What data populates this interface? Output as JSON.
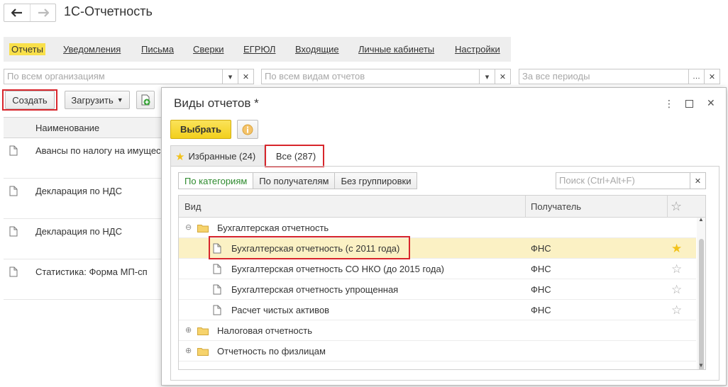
{
  "app": {
    "title": "1С-Отчетность"
  },
  "nav_tabs": [
    {
      "label": "Отчеты",
      "active": true
    },
    {
      "label": "Уведомления",
      "active": false
    },
    {
      "label": "Письма",
      "active": false
    },
    {
      "label": "Сверки",
      "active": false
    },
    {
      "label": "ЕГРЮЛ",
      "active": false
    },
    {
      "label": "Входящие",
      "active": false
    },
    {
      "label": "Личные кабинеты",
      "active": false
    },
    {
      "label": "Настройки",
      "active": false
    }
  ],
  "filters": {
    "organizations_placeholder": "По всем организациям",
    "report_types_placeholder": "По всем видам отчетов",
    "periods_placeholder": "За все периоды"
  },
  "toolbar": {
    "create": "Создать",
    "load": "Загрузить"
  },
  "list": {
    "header": "Наименование",
    "rows": [
      "Авансы по налогу на имущес",
      "Декларация по НДС",
      "Декларация по НДС",
      "Статистика: Форма МП-сп"
    ]
  },
  "dialog": {
    "title": "Виды отчетов *",
    "select_button": "Выбрать",
    "tabs": [
      {
        "label": "Избранные (24)",
        "active": false
      },
      {
        "label": "Все (287)",
        "active": true
      }
    ],
    "grouping": [
      {
        "label": "По категориям",
        "active": true
      },
      {
        "label": "По получателям",
        "active": false
      },
      {
        "label": "Без группировки",
        "active": false
      }
    ],
    "search_placeholder": "Поиск (Ctrl+Alt+F)",
    "columns": {
      "kind": "Вид",
      "recipient": "Получатель"
    },
    "rows": [
      {
        "type": "group",
        "label": "Бухгалтерская отчетность",
        "expanded": true
      },
      {
        "type": "item",
        "label": "Бухгалтерская отчетность (с 2011 года)",
        "recipient": "ФНС",
        "favorite": true,
        "selected": true
      },
      {
        "type": "item",
        "label": "Бухгалтерская отчетность СО НКО (до 2015 года)",
        "recipient": "ФНС",
        "favorite": false
      },
      {
        "type": "item",
        "label": "Бухгалтерская отчетность упрощенная",
        "recipient": "ФНС",
        "favorite": false
      },
      {
        "type": "item",
        "label": "Расчет чистых активов",
        "recipient": "ФНС",
        "favorite": false
      },
      {
        "type": "group",
        "label": "Налоговая отчетность",
        "expanded": false
      },
      {
        "type": "group",
        "label": "Отчетность по физлицам",
        "expanded": false
      }
    ]
  },
  "colors": {
    "accent_yellow": "#f9e04a",
    "highlight_red": "#d8262c",
    "selected_row": "#fbf1c4"
  }
}
